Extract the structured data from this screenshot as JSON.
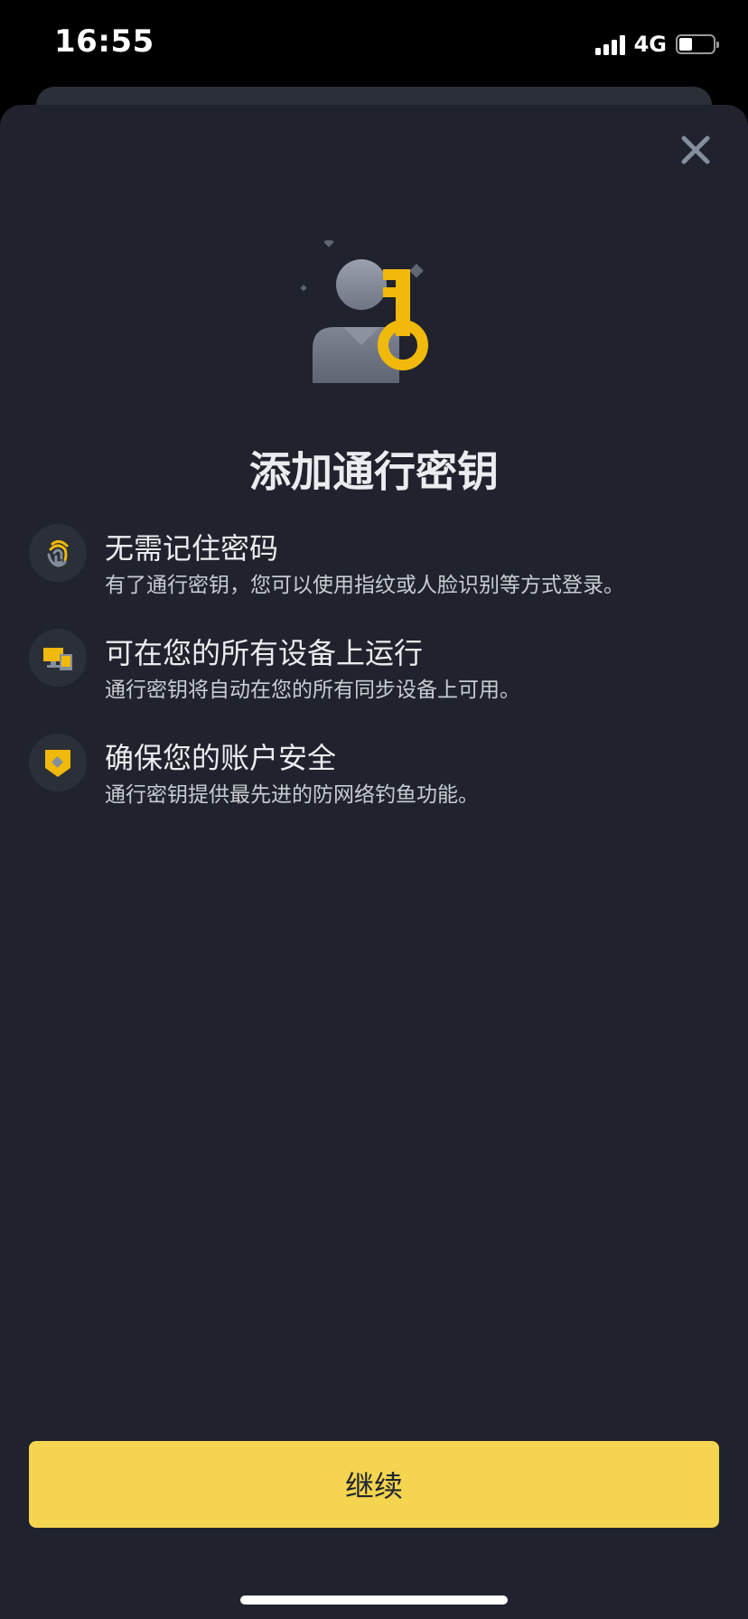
{
  "status_bar": {
    "time": "16:55",
    "network": "4G",
    "battery_level": 0.4
  },
  "sheet": {
    "title": "添加通行密钥",
    "features": [
      {
        "icon": "fingerprint-icon",
        "title": "无需记住密码",
        "description": "有了通行密钥，您可以使用指纹或人脸识别等方式登录。"
      },
      {
        "icon": "devices-icon",
        "title": "可在您的所有设备上运行",
        "description": "通行密钥将自动在您的所有同步设备上可用。"
      },
      {
        "icon": "shield-icon",
        "title": "确保您的账户安全",
        "description": "通行密钥提供最先进的防网络钓鱼功能。"
      }
    ],
    "continue_label": "继续"
  },
  "colors": {
    "background": "#20232D",
    "accent": "#F5D44F",
    "text_primary": "#EAECEF",
    "text_secondary": "#C9CCD2",
    "icon_gray": "#848E9C"
  }
}
